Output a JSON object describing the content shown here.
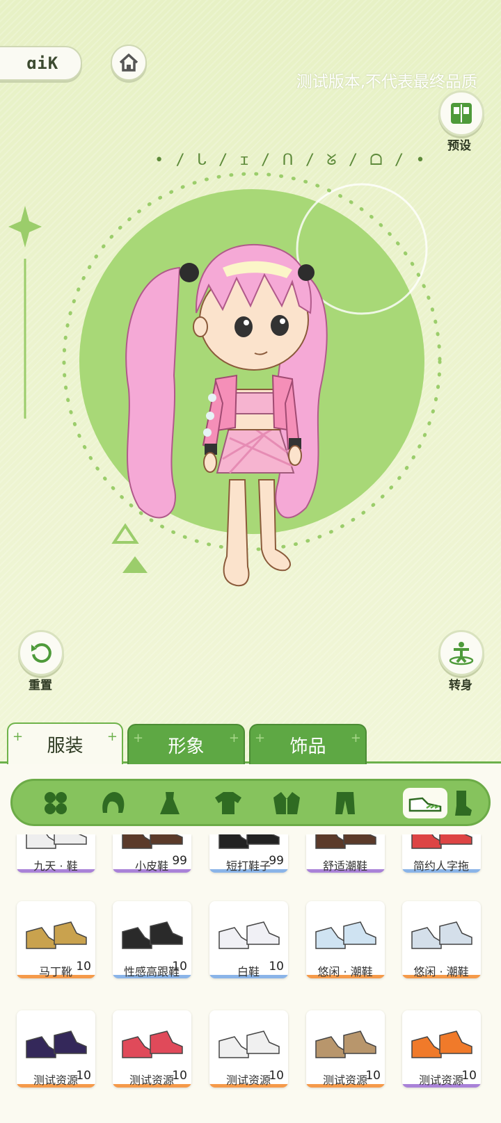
{
  "header": {
    "back_text": "ɑiK",
    "watermark": "测试版本,不代表最终品质",
    "letters": "• / ᒐ / ɪ / ᑎ / ᘜ / ᗝ / •"
  },
  "buttons": {
    "preset_label": "预设",
    "reset_label": "重置",
    "turn_label": "转身"
  },
  "tabs": [
    {
      "label": "服装",
      "active": true
    },
    {
      "label": "形象",
      "active": false
    },
    {
      "label": "饰品",
      "active": false
    }
  ],
  "categories": [
    "clover-icon",
    "hair-icon",
    "dress-icon",
    "shirt-icon",
    "jacket-icon",
    "pants-icon",
    "shoe-icon",
    "sock-icon"
  ],
  "rows": [
    [
      {
        "label": "九天 · 鞋",
        "count": "",
        "rarity": "#a982d8"
      },
      {
        "label": "小皮鞋",
        "count": "99",
        "rarity": "#a982d8"
      },
      {
        "label": "短打鞋子",
        "count": "99",
        "rarity": "#8ab4e8"
      },
      {
        "label": "舒适潮鞋",
        "count": "",
        "rarity": "#a982d8"
      },
      {
        "label": "简约人字拖",
        "count": "",
        "rarity": "#8ab4e8"
      }
    ],
    [
      {
        "label": "马丁靴",
        "count": "10",
        "rarity": "#f59a4a"
      },
      {
        "label": "性感高跟鞋",
        "count": "10",
        "rarity": "#8ab4e8"
      },
      {
        "label": "白鞋",
        "count": "10",
        "rarity": "#8ab4e8"
      },
      {
        "label": "悠闲 · 潮鞋",
        "count": "",
        "rarity": "#f59a4a"
      },
      {
        "label": "悠闲 · 潮鞋",
        "count": "",
        "rarity": "#f59a4a"
      }
    ],
    [
      {
        "label": "测试资源",
        "count": "10",
        "rarity": "#f59a4a"
      },
      {
        "label": "测试资源",
        "count": "10",
        "rarity": "#f59a4a"
      },
      {
        "label": "测试资源",
        "count": "10",
        "rarity": "#f59a4a"
      },
      {
        "label": "测试资源",
        "count": "10",
        "rarity": "#f59a4a"
      },
      {
        "label": "测试资源",
        "count": "10",
        "rarity": "#a982d8"
      }
    ]
  ],
  "colors": {
    "accent": "#6cb04b",
    "bg": "#eef4cf"
  }
}
